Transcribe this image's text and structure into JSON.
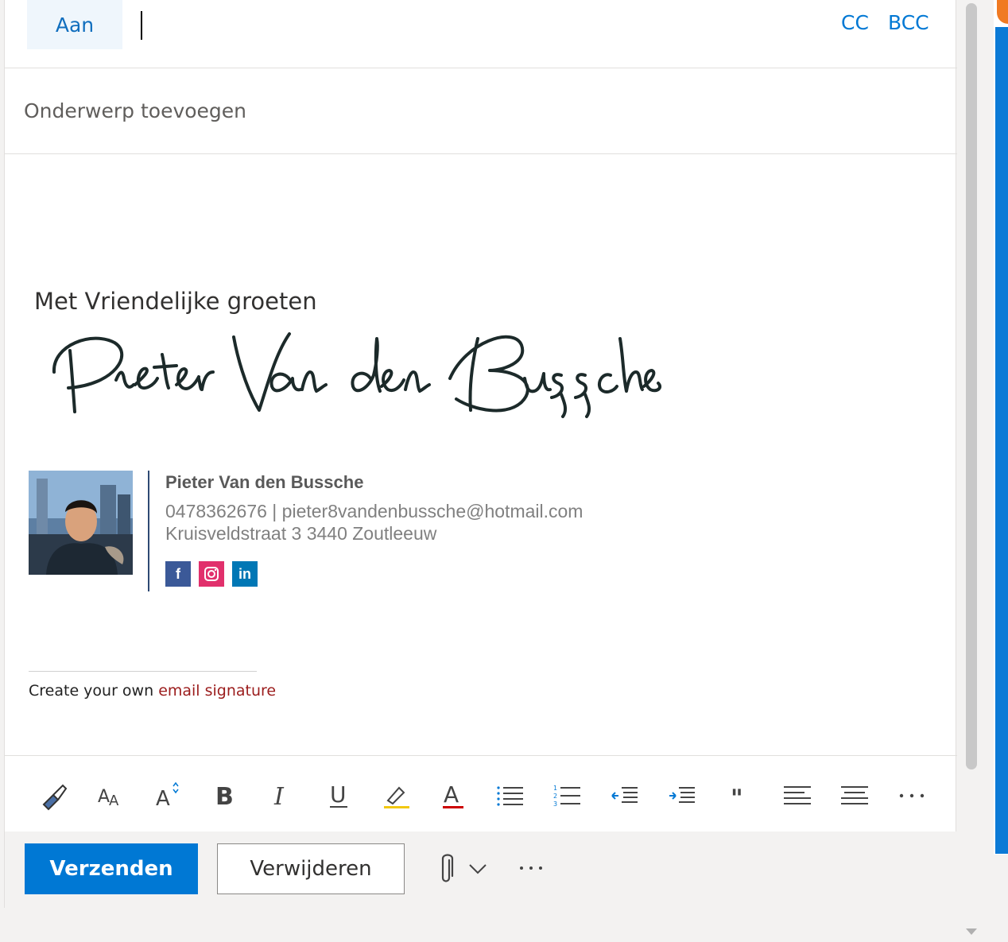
{
  "to_row": {
    "to_label": "Aan",
    "cc_label": "CC",
    "bcc_label": "BCC"
  },
  "subject": {
    "placeholder": "Onderwerp toevoegen"
  },
  "body": {
    "greeting": "Met Vriendelijke groeten",
    "handwritten_signature": "Pieter Van den Bussche",
    "signature": {
      "name": "Pieter Van den Bussche",
      "contact": "0478362676 | pieter8vandenbussche@hotmail.com",
      "address": "Kruisveldstraat 3 3440 Zoutleeuw",
      "social": [
        "facebook-icon",
        "instagram-icon",
        "linkedin-icon"
      ]
    },
    "footer": {
      "prefix": "Create your own ",
      "link_text": "email signature"
    }
  },
  "toolbar": {
    "tools": [
      "format-painter-icon",
      "font-size-icon",
      "grow-font-icon",
      "bold-icon",
      "italic-icon",
      "underline-icon",
      "highlight-icon",
      "font-color-icon",
      "bullets-icon",
      "numbering-icon",
      "decrease-indent-icon",
      "increase-indent-icon",
      "quote-icon",
      "align-left-icon",
      "align-center-icon",
      "more-options-icon"
    ]
  },
  "actions": {
    "send_label": "Verzenden",
    "discard_label": "Verwijderen"
  },
  "colors": {
    "accent": "#0078d4",
    "to_button_bg": "#eff6fc",
    "footer_link": "#9b1c1c",
    "facebook": "#3b5998",
    "instagram": "#e1306c",
    "linkedin": "#0077b5"
  }
}
